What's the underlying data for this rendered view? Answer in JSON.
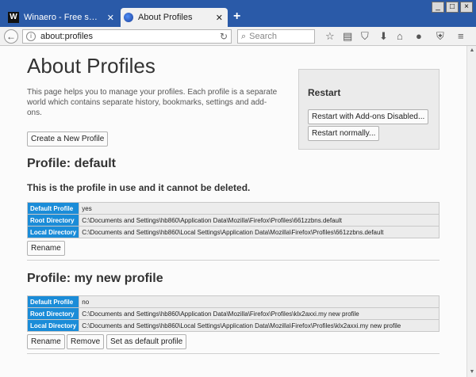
{
  "window": {
    "minimize_icon": "minimize-icon",
    "maximize_icon": "maximize-icon",
    "close_icon": "close-icon"
  },
  "tabs": [
    {
      "label": "Winaero - Free small and usef...",
      "favicon": "W",
      "close": "✕"
    },
    {
      "label": "About Profiles",
      "close": "✕"
    }
  ],
  "new_tab_label": "+",
  "toolbar": {
    "url": "about:profiles",
    "search_placeholder": "Search"
  },
  "page": {
    "title": "About Profiles",
    "intro": "This page helps you to manage your profiles. Each profile is a separate world which contains separate history, bookmarks, settings and add-ons.",
    "create_button": "Create a New Profile"
  },
  "restart": {
    "title": "Restart",
    "addons_disabled_button": "Restart with Add-ons Disabled...",
    "normal_button": "Restart normally..."
  },
  "profiles": [
    {
      "heading": "Profile: default",
      "in_use_note": "This is the profile in use and it cannot be deleted.",
      "rows": [
        {
          "label": "Default Profile",
          "value": "yes"
        },
        {
          "label": "Root Directory",
          "value": "C:\\Documents and Settings\\hb860\\Application Data\\Mozilla\\Firefox\\Profiles\\661zzbns.default"
        },
        {
          "label": "Local Directory",
          "value": "C:\\Documents and Settings\\hb860\\Local Settings\\Application Data\\Mozilla\\Firefox\\Profiles\\661zzbns.default"
        }
      ],
      "buttons": [
        "Rename"
      ]
    },
    {
      "heading": "Profile: my new profile",
      "rows": [
        {
          "label": "Default Profile",
          "value": "no"
        },
        {
          "label": "Root Directory",
          "value": "C:\\Documents and Settings\\hb860\\Application Data\\Mozilla\\Firefox\\Profiles\\klx2axxi.my new profile"
        },
        {
          "label": "Local Directory",
          "value": "C:\\Documents and Settings\\hb860\\Local Settings\\Application Data\\Mozilla\\Firefox\\Profiles\\klx2axxi.my new profile"
        }
      ],
      "buttons": [
        "Rename",
        "Remove",
        "Set as default profile"
      ]
    }
  ],
  "colors": {
    "title_bar": "#2a5aa8",
    "label_cell": "#1a8cd8",
    "content_bg": "#fbfbfb"
  }
}
